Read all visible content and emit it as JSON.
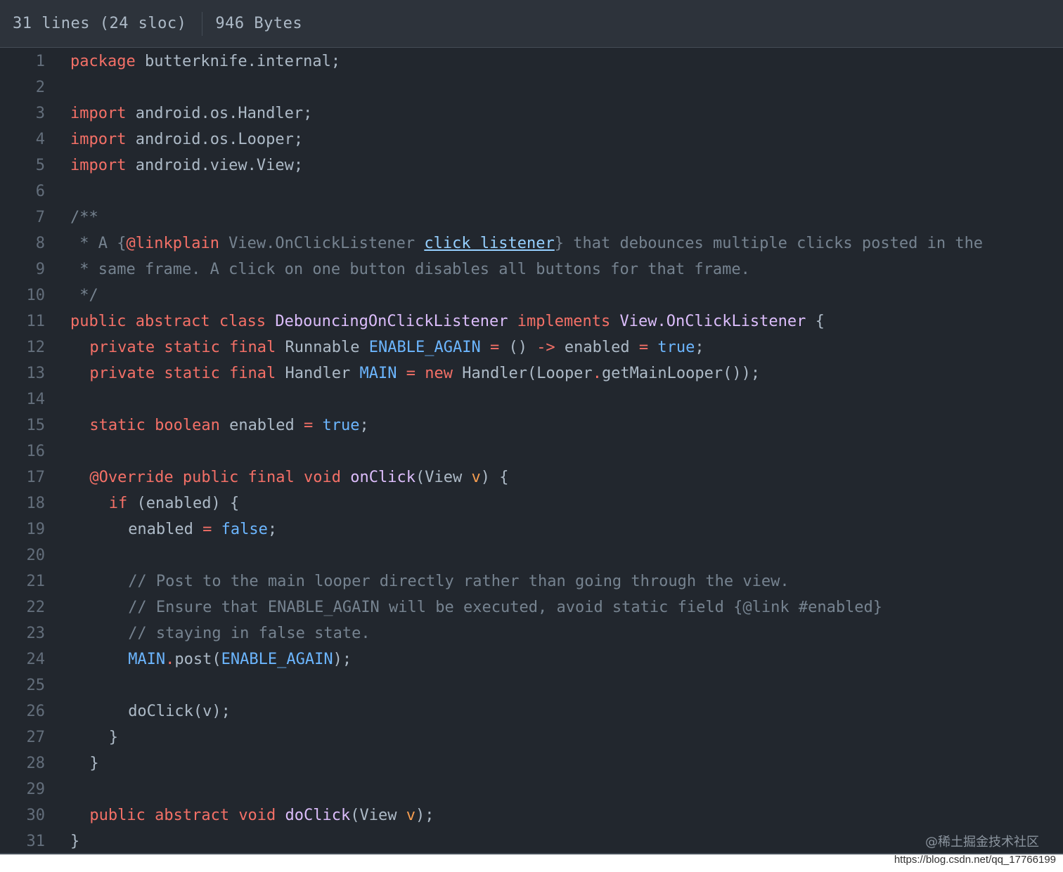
{
  "header": {
    "lines_info": "31 lines (24 sloc)",
    "size_info": "946 Bytes"
  },
  "code": [
    {
      "n": "1",
      "indent": 0,
      "tokens": [
        [
          "kw",
          "package"
        ],
        [
          "plain",
          " butterknife.internal;"
        ]
      ]
    },
    {
      "n": "2",
      "indent": 0,
      "tokens": []
    },
    {
      "n": "3",
      "indent": 0,
      "tokens": [
        [
          "kw",
          "import"
        ],
        [
          "plain",
          " android.os.Handler;"
        ]
      ]
    },
    {
      "n": "4",
      "indent": 0,
      "tokens": [
        [
          "kw",
          "import"
        ],
        [
          "plain",
          " android.os.Looper;"
        ]
      ]
    },
    {
      "n": "5",
      "indent": 0,
      "tokens": [
        [
          "kw",
          "import"
        ],
        [
          "plain",
          " android.view.View;"
        ]
      ]
    },
    {
      "n": "6",
      "indent": 0,
      "tokens": []
    },
    {
      "n": "7",
      "indent": 0,
      "tokens": [
        [
          "cm",
          "/**"
        ]
      ]
    },
    {
      "n": "8",
      "indent": 0,
      "tokens": [
        [
          "cm",
          " * A {"
        ],
        [
          "kw",
          "@linkplain"
        ],
        [
          "cm",
          " View.OnClickListener "
        ],
        [
          "link",
          "click listener"
        ],
        [
          "cm",
          "} that debounces multiple clicks posted in the"
        ]
      ]
    },
    {
      "n": "9",
      "indent": 0,
      "tokens": [
        [
          "cm",
          " * same frame. A click on one button disables all buttons for that frame."
        ]
      ]
    },
    {
      "n": "10",
      "indent": 0,
      "tokens": [
        [
          "cm",
          " */"
        ]
      ]
    },
    {
      "n": "11",
      "indent": 0,
      "tokens": [
        [
          "kw",
          "public abstract class"
        ],
        [
          "plain",
          " "
        ],
        [
          "cls",
          "DebouncingOnClickListener"
        ],
        [
          "plain",
          " "
        ],
        [
          "kw",
          "implements"
        ],
        [
          "plain",
          " "
        ],
        [
          "cls",
          "View.OnClickListener"
        ],
        [
          "plain",
          " {"
        ]
      ]
    },
    {
      "n": "12",
      "indent": 2,
      "tokens": [
        [
          "kw",
          "private static final"
        ],
        [
          "plain",
          " Runnable "
        ],
        [
          "const",
          "ENABLE_AGAIN"
        ],
        [
          "plain",
          " "
        ],
        [
          "kw",
          "="
        ],
        [
          "plain",
          " () "
        ],
        [
          "kw",
          "->"
        ],
        [
          "plain",
          " enabled "
        ],
        [
          "kw",
          "="
        ],
        [
          "plain",
          " "
        ],
        [
          "const",
          "true"
        ],
        [
          "plain",
          ";"
        ]
      ]
    },
    {
      "n": "13",
      "indent": 2,
      "tokens": [
        [
          "kw",
          "private static final"
        ],
        [
          "plain",
          " Handler "
        ],
        [
          "const",
          "MAIN"
        ],
        [
          "plain",
          " "
        ],
        [
          "kw",
          "="
        ],
        [
          "plain",
          " "
        ],
        [
          "kw",
          "new"
        ],
        [
          "plain",
          " Handler(Looper"
        ],
        [
          "kw",
          "."
        ],
        [
          "plain",
          "getMainLooper());"
        ]
      ]
    },
    {
      "n": "14",
      "indent": 0,
      "tokens": []
    },
    {
      "n": "15",
      "indent": 2,
      "tokens": [
        [
          "kw",
          "static boolean"
        ],
        [
          "plain",
          " enabled "
        ],
        [
          "kw",
          "="
        ],
        [
          "plain",
          " "
        ],
        [
          "const",
          "true"
        ],
        [
          "plain",
          ";"
        ]
      ]
    },
    {
      "n": "16",
      "indent": 0,
      "tokens": []
    },
    {
      "n": "17",
      "indent": 2,
      "tokens": [
        [
          "kw",
          "@Override public final void"
        ],
        [
          "plain",
          " "
        ],
        [
          "cls",
          "onClick"
        ],
        [
          "plain",
          "(View "
        ],
        [
          "param",
          "v"
        ],
        [
          "plain",
          ") {"
        ]
      ]
    },
    {
      "n": "18",
      "indent": 4,
      "tokens": [
        [
          "kw",
          "if"
        ],
        [
          "plain",
          " (enabled) {"
        ]
      ]
    },
    {
      "n": "19",
      "indent": 6,
      "tokens": [
        [
          "plain",
          "enabled "
        ],
        [
          "kw",
          "="
        ],
        [
          "plain",
          " "
        ],
        [
          "const",
          "false"
        ],
        [
          "plain",
          ";"
        ]
      ]
    },
    {
      "n": "20",
      "indent": 0,
      "tokens": []
    },
    {
      "n": "21",
      "indent": 6,
      "tokens": [
        [
          "cm",
          "// Post to the main looper directly rather than going through the view."
        ]
      ]
    },
    {
      "n": "22",
      "indent": 6,
      "tokens": [
        [
          "cm",
          "// Ensure that ENABLE_AGAIN will be executed, avoid static field {@link #enabled}"
        ]
      ]
    },
    {
      "n": "23",
      "indent": 6,
      "tokens": [
        [
          "cm",
          "// staying in false state."
        ]
      ]
    },
    {
      "n": "24",
      "indent": 6,
      "tokens": [
        [
          "const",
          "MAIN"
        ],
        [
          "kw",
          "."
        ],
        [
          "plain",
          "post("
        ],
        [
          "const",
          "ENABLE_AGAIN"
        ],
        [
          "plain",
          ");"
        ]
      ]
    },
    {
      "n": "25",
      "indent": 0,
      "tokens": []
    },
    {
      "n": "26",
      "indent": 6,
      "tokens": [
        [
          "plain",
          "doClick(v);"
        ]
      ]
    },
    {
      "n": "27",
      "indent": 4,
      "tokens": [
        [
          "plain",
          "}"
        ]
      ]
    },
    {
      "n": "28",
      "indent": 2,
      "tokens": [
        [
          "plain",
          "}"
        ]
      ]
    },
    {
      "n": "29",
      "indent": 0,
      "tokens": []
    },
    {
      "n": "30",
      "indent": 2,
      "tokens": [
        [
          "kw",
          "public abstract void"
        ],
        [
          "plain",
          " "
        ],
        [
          "cls",
          "doClick"
        ],
        [
          "plain",
          "(View "
        ],
        [
          "param",
          "v"
        ],
        [
          "plain",
          ");"
        ]
      ]
    },
    {
      "n": "31",
      "indent": 0,
      "tokens": [
        [
          "plain",
          "}"
        ]
      ]
    }
  ],
  "watermark": {
    "community": "@稀土掘金技术社区",
    "url": "https://blog.csdn.net/qq_17766199"
  }
}
